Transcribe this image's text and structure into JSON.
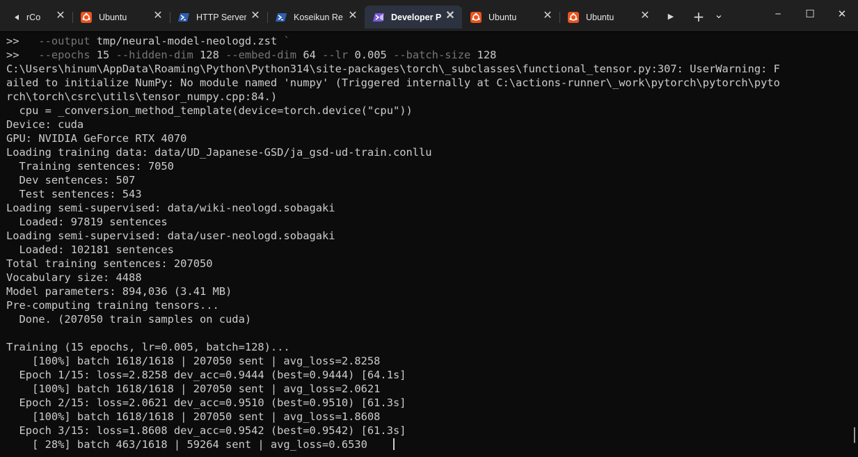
{
  "tabs": [
    {
      "label": "rCo",
      "icon": "scroll-left-icon",
      "active": false
    },
    {
      "label": "Ubuntu",
      "icon": "ubuntu-icon",
      "active": false
    },
    {
      "label": "HTTP Server",
      "icon": "powershell-icon",
      "active": false
    },
    {
      "label": "Koseikun Re",
      "icon": "powershell-icon",
      "active": false
    },
    {
      "label": "Developer P",
      "icon": "developer-powershell-icon",
      "active": true
    },
    {
      "label": "Ubuntu",
      "icon": "ubuntu-icon",
      "active": false
    },
    {
      "label": "Ubuntu",
      "icon": "ubuntu-icon",
      "active": false
    }
  ],
  "tabbar": {
    "close_glyph": "✕",
    "scroll_right_glyph": "▶",
    "new_tab_glyph": "+",
    "dropdown_glyph": "⌄"
  },
  "window": {
    "minimize_glyph": "─",
    "maximize_glyph": "☐",
    "close_glyph": "✕"
  },
  "colors": {
    "background": "#0c0c0c",
    "foreground": "#cccccc",
    "dim_flag": "#767676",
    "tab_active": "#2d3240",
    "ubuntu_orange": "#e95420",
    "powershell_blue": "#2f5fb3"
  },
  "terminal": {
    "lines": [
      [
        {
          "t": ">>   "
        },
        {
          "t": "--output",
          "c": "flag"
        },
        {
          "t": " tmp/neural-model-neologd.zst "
        },
        {
          "t": "`",
          "c": "flag"
        }
      ],
      [
        {
          "t": ">>   "
        },
        {
          "t": "--epochs",
          "c": "flag"
        },
        {
          "t": " 15 "
        },
        {
          "t": "--hidden-dim",
          "c": "flag"
        },
        {
          "t": " 128 "
        },
        {
          "t": "--embed-dim",
          "c": "flag"
        },
        {
          "t": " 64 "
        },
        {
          "t": "--lr",
          "c": "flag"
        },
        {
          "t": " 0.005 "
        },
        {
          "t": "--batch-size",
          "c": "flag"
        },
        {
          "t": " 128"
        }
      ],
      [
        {
          "t": "C:\\Users\\hinum\\AppData\\Roaming\\Python\\Python314\\site-packages\\torch\\_subclasses\\functional_tensor.py:307: UserWarning: F"
        }
      ],
      [
        {
          "t": "ailed to initialize NumPy: No module named 'numpy' (Triggered internally at C:\\actions-runner\\_work\\pytorch\\pytorch\\pyto"
        }
      ],
      [
        {
          "t": "rch\\torch\\csrc\\utils\\tensor_numpy.cpp:84.)"
        }
      ],
      [
        {
          "t": "  cpu = _conversion_method_template(device=torch.device(\"cpu\"))"
        }
      ],
      [
        {
          "t": "Device: cuda"
        }
      ],
      [
        {
          "t": "GPU: NVIDIA GeForce RTX 4070"
        }
      ],
      [
        {
          "t": "Loading training data: data/UD_Japanese-GSD/ja_gsd-ud-train.conllu"
        }
      ],
      [
        {
          "t": "  Training sentences: 7050"
        }
      ],
      [
        {
          "t": "  Dev sentences: 507"
        }
      ],
      [
        {
          "t": "  Test sentences: 543"
        }
      ],
      [
        {
          "t": "Loading semi-supervised: data/wiki-neologd.sobagaki"
        }
      ],
      [
        {
          "t": "  Loaded: 97819 sentences"
        }
      ],
      [
        {
          "t": "Loading semi-supervised: data/user-neologd.sobagaki"
        }
      ],
      [
        {
          "t": "  Loaded: 102181 sentences"
        }
      ],
      [
        {
          "t": "Total training sentences: 207050"
        }
      ],
      [
        {
          "t": "Vocabulary size: 4488"
        }
      ],
      [
        {
          "t": "Model parameters: 894,036 (3.41 MB)"
        }
      ],
      [
        {
          "t": "Pre-computing training tensors..."
        }
      ],
      [
        {
          "t": "  Done. (207050 train samples on cuda)"
        }
      ],
      [
        {
          "t": ""
        }
      ],
      [
        {
          "t": "Training (15 epochs, lr=0.005, batch=128)..."
        }
      ],
      [
        {
          "t": "    [100%] batch 1618/1618 | 207050 sent | avg_loss=2.8258"
        }
      ],
      [
        {
          "t": "  Epoch 1/15: loss=2.8258 dev_acc=0.9444 (best=0.9444) [64.1s]"
        }
      ],
      [
        {
          "t": "    [100%] batch 1618/1618 | 207050 sent | avg_loss=2.0621"
        }
      ],
      [
        {
          "t": "  Epoch 2/15: loss=2.0621 dev_acc=0.9510 (best=0.9510) [61.3s]"
        }
      ],
      [
        {
          "t": "    [100%] batch 1618/1618 | 207050 sent | avg_loss=1.8608"
        }
      ],
      [
        {
          "t": "  Epoch 3/15: loss=1.8608 dev_acc=0.9542 (best=0.9542) [61.3s]"
        }
      ],
      [
        {
          "t": "    [ 28%] batch 463/1618 | 59264 sent | avg_loss=0.6530    "
        },
        {
          "cursor": true
        }
      ]
    ]
  }
}
